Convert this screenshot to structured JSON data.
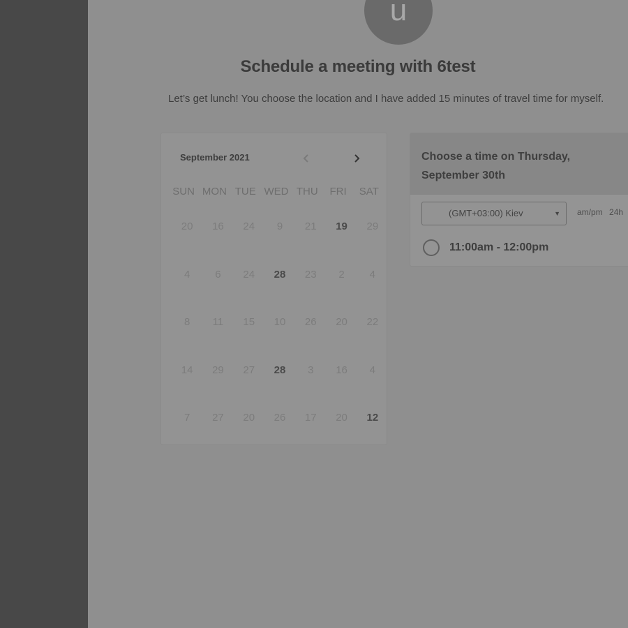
{
  "avatar": {
    "initial": "u"
  },
  "header": {
    "title": "Schedule a meeting with 6test",
    "subtitle": "Let’s get lunch! You choose the location and I have added 15 minutes of travel time for myself."
  },
  "calendar": {
    "month_label": "September 2021",
    "weekdays": [
      "SUN",
      "MON",
      "TUE",
      "WED",
      "THU",
      "FRI",
      "SAT"
    ],
    "weeks": [
      [
        "20",
        "16",
        "24",
        "9",
        "21",
        "19",
        "29"
      ],
      [
        "4",
        "6",
        "24",
        "28",
        "23",
        "2",
        "4"
      ],
      [
        "8",
        "11",
        "15",
        "10",
        "26",
        "20",
        "22"
      ],
      [
        "14",
        "29",
        "27",
        "28",
        "3",
        "16",
        "4"
      ],
      [
        "7",
        "27",
        "20",
        "26",
        "17",
        "20",
        "12"
      ]
    ],
    "available": [
      "19",
      "28",
      "12"
    ]
  },
  "time_panel": {
    "title": "Choose a time on Thursday, September 30th",
    "timezone": "(GMT+03:00) Kiev",
    "format_12": "am/pm",
    "format_24": "24h",
    "slot": "11:00am - 12:00pm"
  }
}
